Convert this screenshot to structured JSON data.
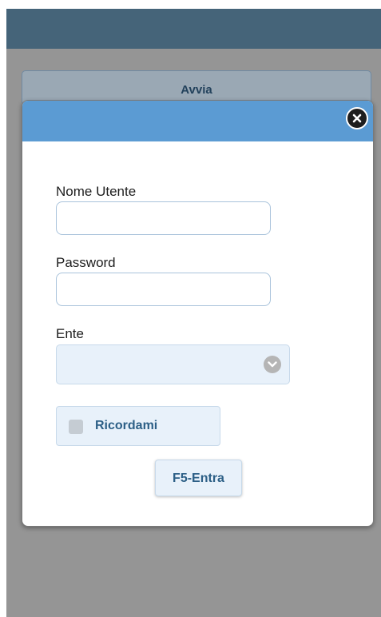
{
  "background": {
    "start_button_label": "Avvia"
  },
  "login_dialog": {
    "close_icon": "close-icon",
    "username_label": "Nome Utente",
    "username_value": "",
    "password_label": "Password",
    "password_value": "",
    "organization_label": "Ente",
    "organization_value": "",
    "organization_icon": "chevron-down-icon",
    "remember_label": "Ricordami",
    "remember_checked": false,
    "enter_button_label": "F5-Entra"
  },
  "colors": {
    "header_bar": "#456479",
    "dialog_header": "#5b9bd3",
    "overlay": "#959595",
    "button_bg": "#e8f1fa",
    "button_text": "#2c5f86"
  }
}
